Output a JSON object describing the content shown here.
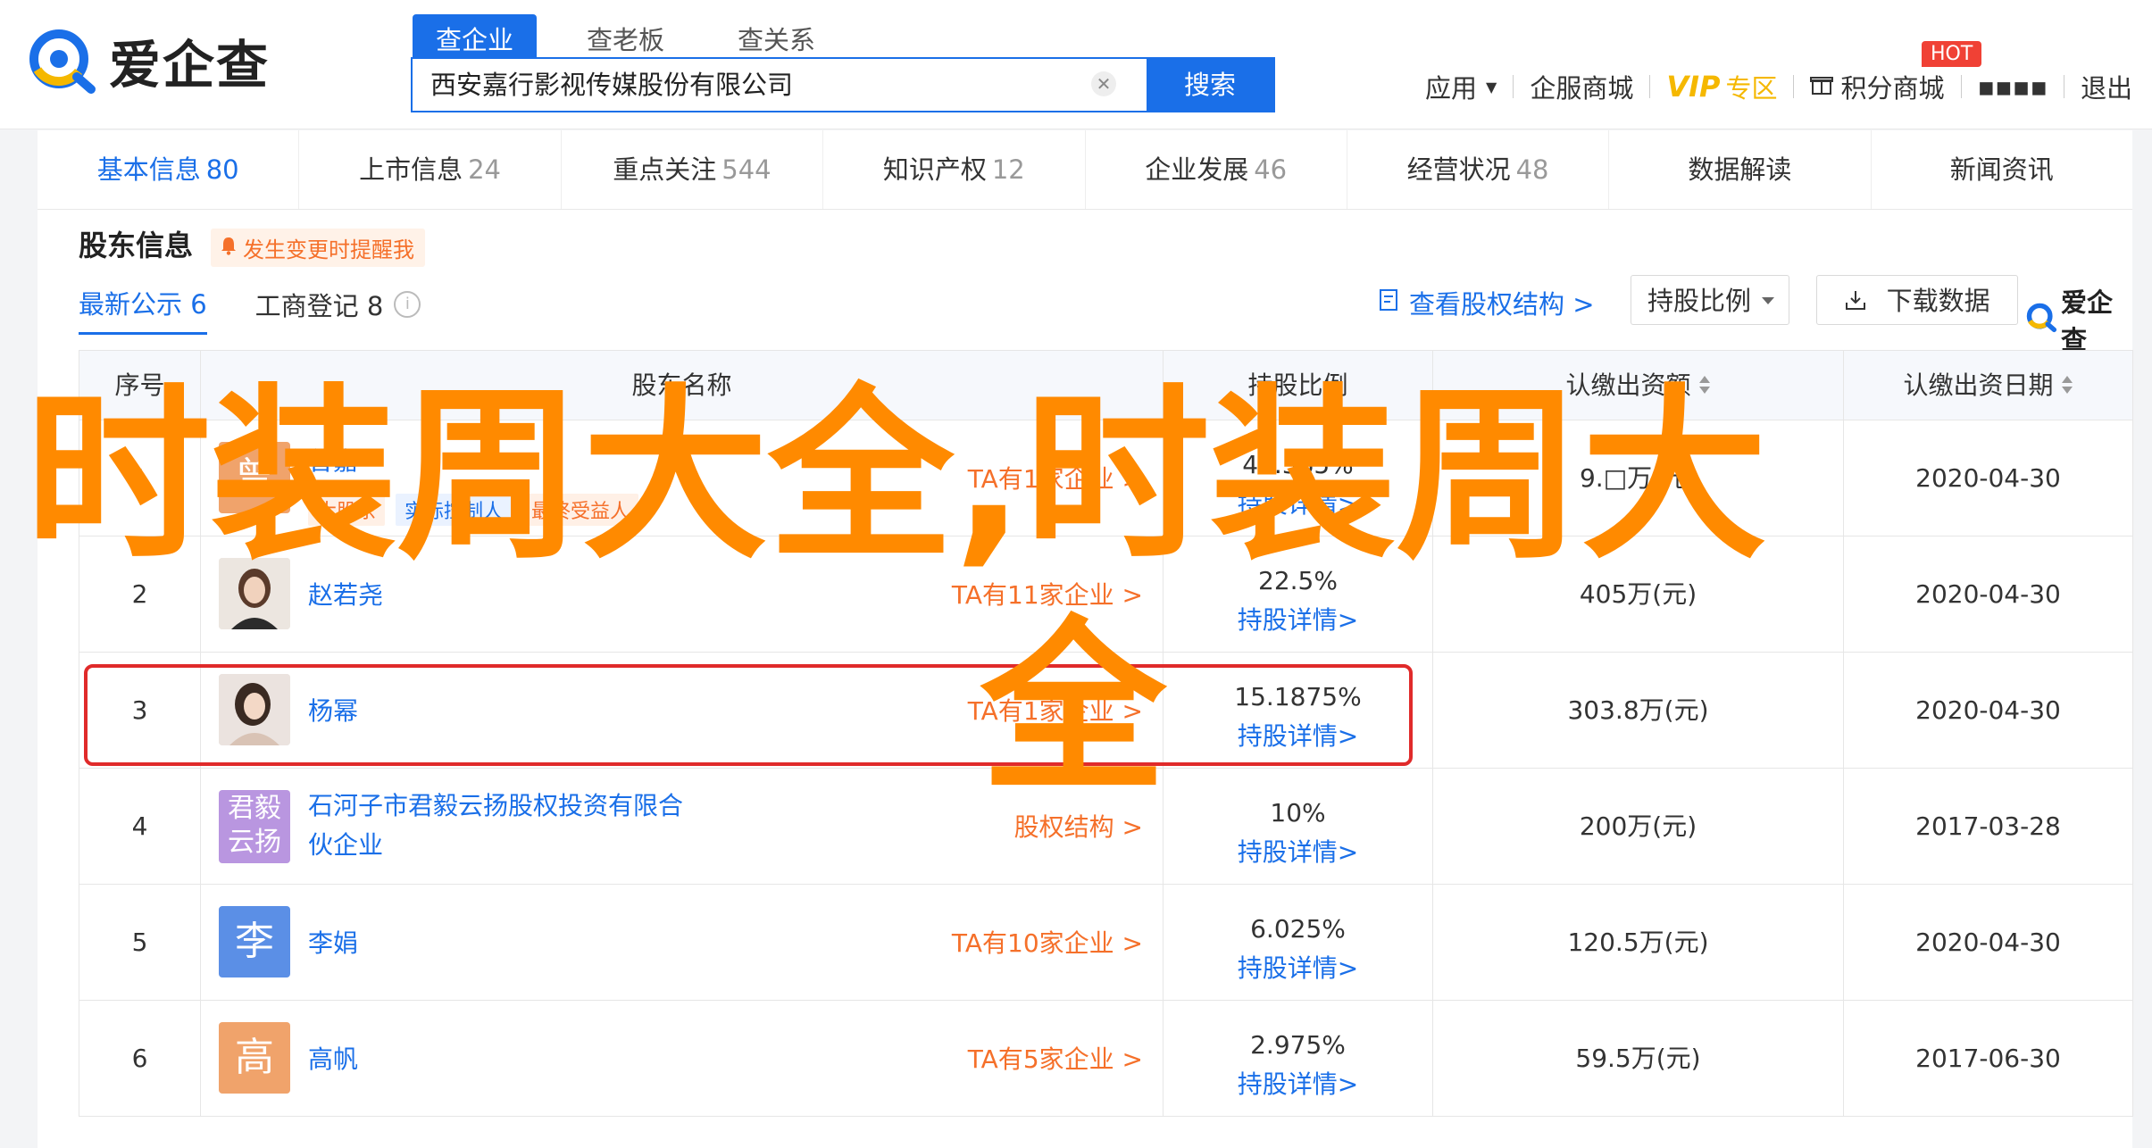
{
  "header": {
    "logo_text": "爱企查",
    "search_tabs": [
      "查企业",
      "查老板",
      "查关系"
    ],
    "search_value": "西安嘉行影视传媒股份有限公司",
    "search_button": "搜索",
    "nav": {
      "apps": "应用",
      "service_mall": "企服商城",
      "vip": "VIP",
      "vip_area": "专区",
      "points_mall": "积分商城",
      "hot": "HOT",
      "user": "▪▪▪▪",
      "logout": "退出"
    }
  },
  "tabs": [
    {
      "label": "基本信息",
      "count": "80"
    },
    {
      "label": "上市信息",
      "count": "24"
    },
    {
      "label": "重点关注",
      "count": "544"
    },
    {
      "label": "知识产权",
      "count": "12"
    },
    {
      "label": "企业发展",
      "count": "46"
    },
    {
      "label": "经营状况",
      "count": "48"
    },
    {
      "label": "数据解读",
      "count": ""
    },
    {
      "label": "新闻资讯",
      "count": ""
    }
  ],
  "section": {
    "title": "股东信息",
    "alert": "发生变更时提醒我",
    "subtab_latest": "最新公示 6",
    "subtab_registry": "工商登记 8",
    "info_glyph": "i",
    "equity_link": "查看股权结构 >",
    "ratio_dropdown": "持股比例",
    "download": "下载数据",
    "mini_logo": "爱企查"
  },
  "table": {
    "headers": [
      "序号",
      "股东名称",
      "持股比例",
      "认缴出资额",
      "认缴出资日期"
    ],
    "detail_link": "持股详情>",
    "rows": [
      {
        "idx": "1",
        "avatar": "曾",
        "name": "曾嘉",
        "ta": "TA有1家企业 >",
        "tags": [
          "大股东",
          "实际控制人",
          "最终受益人"
        ],
        "ratio": "45.565%",
        "amount": "9.□万(元)",
        "date": "2020-04-30"
      },
      {
        "idx": "2",
        "avatar": "",
        "name": "赵若尧",
        "ta": "TA有11家企业 >",
        "ratio": "22.5%",
        "amount": "405万(元)",
        "date": "2020-04-30"
      },
      {
        "idx": "3",
        "avatar": "",
        "name": "杨幂",
        "ta": "TA有1家企业 >",
        "ratio": "15.1875%",
        "amount": "303.8万(元)",
        "date": "2020-04-30"
      },
      {
        "idx": "4",
        "avatar": "君毅云扬",
        "name": "石河子市君毅云扬股权投资有限合伙企业",
        "ta": "股权结构 >",
        "ratio": "10%",
        "amount": "200万(元)",
        "date": "2017-03-28"
      },
      {
        "idx": "5",
        "avatar": "李",
        "name": "李娟",
        "ta": "TA有10家企业 >",
        "ratio": "6.025%",
        "amount": "120.5万(元)",
        "date": "2020-04-30"
      },
      {
        "idx": "6",
        "avatar": "高",
        "name": "高帆",
        "ta": "TA有5家企业 >",
        "ratio": "2.975%",
        "amount": "59.5万(元)",
        "date": "2017-06-30"
      }
    ]
  },
  "overlay": {
    "line1": "时装周大全,时装周大",
    "line2": "全"
  },
  "colors": {
    "primary": "#1a6fe8",
    "orange": "#f5702a",
    "overlay": "#ff8a00",
    "highlight": "#e02a2a",
    "avatar_zeng": "#f0a36b",
    "avatar_junyi": "#b996e0",
    "avatar_li": "#5b8fe6",
    "avatar_gao": "#f0a36b"
  }
}
